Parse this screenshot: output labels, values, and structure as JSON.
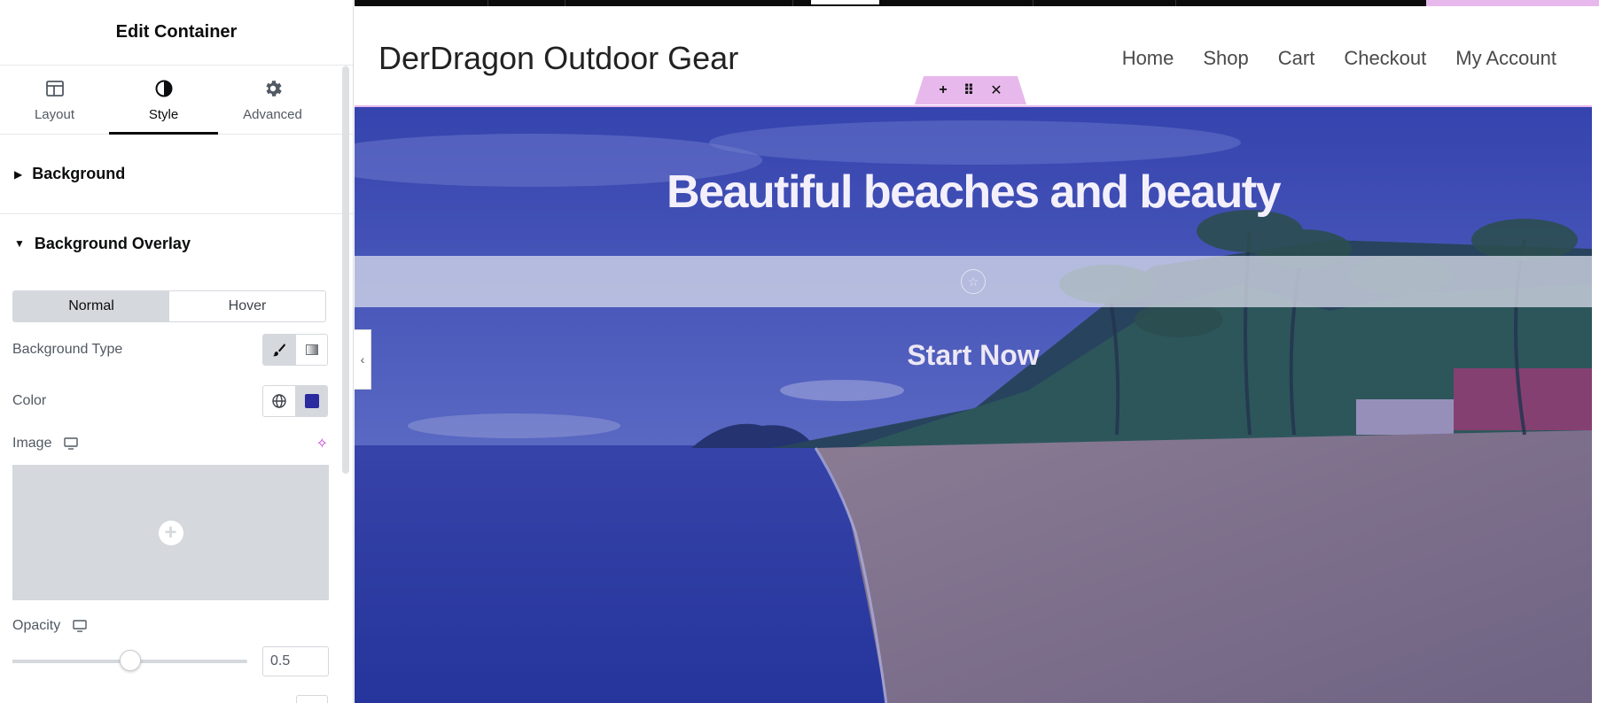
{
  "panel": {
    "title": "Edit Container",
    "tabs": [
      {
        "label": "Layout",
        "icon": "layout-icon"
      },
      {
        "label": "Style",
        "icon": "contrast-icon"
      },
      {
        "label": "Advanced",
        "icon": "gear-icon"
      }
    ],
    "sections": {
      "background": "Background",
      "overlay": "Background Overlay"
    },
    "state_toggle": {
      "normal": "Normal",
      "hover": "Hover"
    },
    "fields": {
      "background_type": "Background Type",
      "color": "Color",
      "image": "Image",
      "opacity": "Opacity",
      "opacity_value": "0.5"
    },
    "opacity_slider_value": 0.5,
    "overlay_color": "#2b2a9e"
  },
  "preview": {
    "site_title": "DerDragon Outdoor Gear",
    "nav": [
      "Home",
      "Shop",
      "Cart",
      "Checkout",
      "My Account"
    ],
    "handle": {
      "add": "+",
      "move": "⠿",
      "close": "✕"
    },
    "hero_title": "Beautiful beaches and beauty",
    "cta": "Start Now"
  },
  "colors": {
    "accent": "#e7b8ec",
    "overlay": "#2b2a9e",
    "panel_text": "#0c0d0e"
  }
}
